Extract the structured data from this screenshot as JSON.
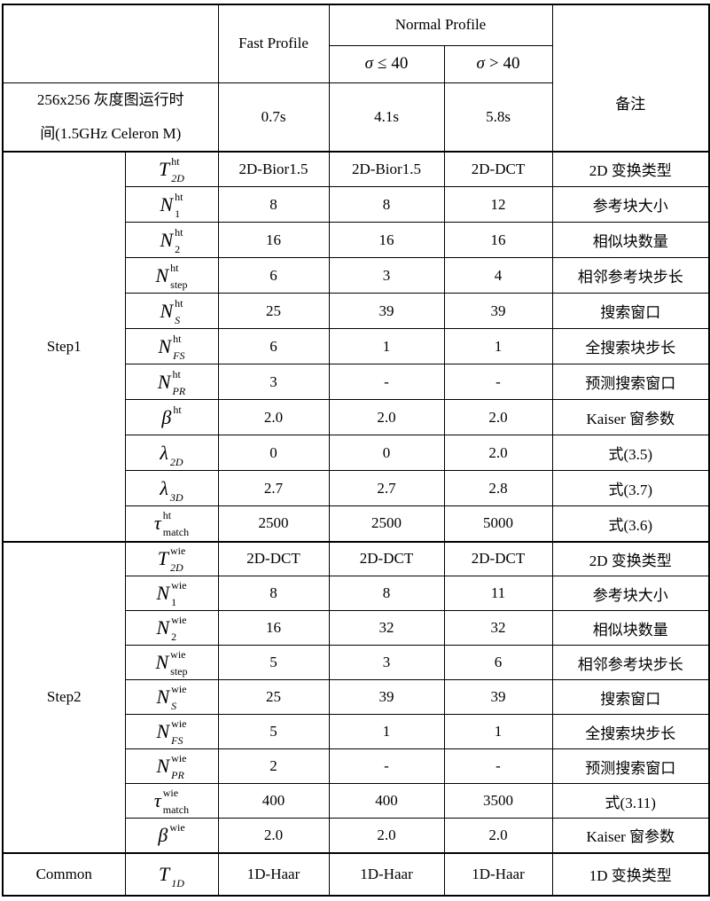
{
  "header": {
    "fast_profile": "Fast Profile",
    "normal_profile": "Normal Profile",
    "sigma_le": {
      "symbol": "σ",
      "relation": "≤",
      "value": "40"
    },
    "sigma_gt": {
      "symbol": "σ",
      "relation": ">",
      "value": "40"
    },
    "remarks": "备注"
  },
  "runtime": {
    "label_line1": "256x256 灰度图运行时",
    "label_line2": "间(1.5GHz Celeron M)",
    "fast": "0.7s",
    "normal_le40": "4.1s",
    "normal_gt40": "5.8s"
  },
  "step1": {
    "label": "Step1",
    "rows": [
      {
        "param": {
          "base": "T",
          "sup": "ht",
          "sub": "2D",
          "sub_italic": true
        },
        "fast": "2D-Bior1.5",
        "normal_le40": "2D-Bior1.5",
        "normal_gt40": "2D-DCT",
        "note": "2D 变换类型"
      },
      {
        "param": {
          "base": "N",
          "sup": "ht",
          "sub": "1",
          "sub_italic": false
        },
        "fast": "8",
        "normal_le40": "8",
        "normal_gt40": "12",
        "note": "参考块大小"
      },
      {
        "param": {
          "base": "N",
          "sup": "ht",
          "sub": "2",
          "sub_italic": false
        },
        "fast": "16",
        "normal_le40": "16",
        "normal_gt40": "16",
        "note": "相似块数量"
      },
      {
        "param": {
          "base": "N",
          "sup": "ht",
          "sub": "step",
          "sub_italic": false
        },
        "fast": "6",
        "normal_le40": "3",
        "normal_gt40": "4",
        "note": "相邻参考块步长"
      },
      {
        "param": {
          "base": "N",
          "sup": "ht",
          "sub": "S",
          "sub_italic": true
        },
        "fast": "25",
        "normal_le40": "39",
        "normal_gt40": "39",
        "note": "搜索窗口"
      },
      {
        "param": {
          "base": "N",
          "sup": "ht",
          "sub": "FS",
          "sub_italic": true
        },
        "fast": "6",
        "normal_le40": "1",
        "normal_gt40": "1",
        "note": "全搜索块步长"
      },
      {
        "param": {
          "base": "N",
          "sup": "ht",
          "sub": "PR",
          "sub_italic": true
        },
        "fast": "3",
        "normal_le40": "-",
        "normal_gt40": "-",
        "note": "预测搜索窗口"
      },
      {
        "param": {
          "base": "β",
          "sup": "ht"
        },
        "fast": "2.0",
        "normal_le40": "2.0",
        "normal_gt40": "2.0",
        "note": "Kaiser 窗参数"
      },
      {
        "param": {
          "base": "λ",
          "sub": "2D",
          "sub_italic": true
        },
        "fast": "0",
        "normal_le40": "0",
        "normal_gt40": "2.0",
        "note": "式(3.5)"
      },
      {
        "param": {
          "base": "λ",
          "sub": "3D",
          "sub_italic": true
        },
        "fast": "2.7",
        "normal_le40": "2.7",
        "normal_gt40": "2.8",
        "note": "式(3.7)"
      },
      {
        "param": {
          "base": "τ",
          "sup": "ht",
          "sub": "match",
          "sub_italic": false
        },
        "fast": "2500",
        "normal_le40": "2500",
        "normal_gt40": "5000",
        "note": "式(3.6)"
      }
    ]
  },
  "step2": {
    "label": "Step2",
    "rows": [
      {
        "param": {
          "base": "T",
          "sup": "wie",
          "sub": "2D",
          "sub_italic": true
        },
        "fast": "2D-DCT",
        "normal_le40": "2D-DCT",
        "normal_gt40": "2D-DCT",
        "note": "2D 变换类型"
      },
      {
        "param": {
          "base": "N",
          "sup": "wie",
          "sub": "1",
          "sub_italic": false
        },
        "fast": "8",
        "normal_le40": "8",
        "normal_gt40": "11",
        "note": "参考块大小"
      },
      {
        "param": {
          "base": "N",
          "sup": "wie",
          "sub": "2",
          "sub_italic": false
        },
        "fast": "16",
        "normal_le40": "32",
        "normal_gt40": "32",
        "note": "相似块数量"
      },
      {
        "param": {
          "base": "N",
          "sup": "wie",
          "sub": "step",
          "sub_italic": false
        },
        "fast": "5",
        "normal_le40": "3",
        "normal_gt40": "6",
        "note": "相邻参考块步长"
      },
      {
        "param": {
          "base": "N",
          "sup": "wie",
          "sub": "S",
          "sub_italic": true
        },
        "fast": "25",
        "normal_le40": "39",
        "normal_gt40": "39",
        "note": "搜索窗口"
      },
      {
        "param": {
          "base": "N",
          "sup": "wie",
          "sub": "FS",
          "sub_italic": true
        },
        "fast": "5",
        "normal_le40": "1",
        "normal_gt40": "1",
        "note": "全搜索块步长"
      },
      {
        "param": {
          "base": "N",
          "sup": "wie",
          "sub": "PR",
          "sub_italic": true
        },
        "fast": "2",
        "normal_le40": "-",
        "normal_gt40": "-",
        "note": "预测搜索窗口"
      },
      {
        "param": {
          "base": "τ",
          "sup": "wie",
          "sub": "match",
          "sub_italic": false
        },
        "fast": "400",
        "normal_le40": "400",
        "normal_gt40": "3500",
        "note": "式(3.11)"
      },
      {
        "param": {
          "base": "β",
          "sup": "wie"
        },
        "fast": "2.0",
        "normal_le40": "2.0",
        "normal_gt40": "2.0",
        "note": "Kaiser 窗参数"
      }
    ]
  },
  "common": {
    "label": "Common",
    "rows": [
      {
        "param": {
          "base": "T",
          "sub": "1D",
          "sub_italic": true
        },
        "fast": "1D-Haar",
        "normal_le40": "1D-Haar",
        "normal_gt40": "1D-Haar",
        "note": "1D 变换类型"
      }
    ]
  }
}
